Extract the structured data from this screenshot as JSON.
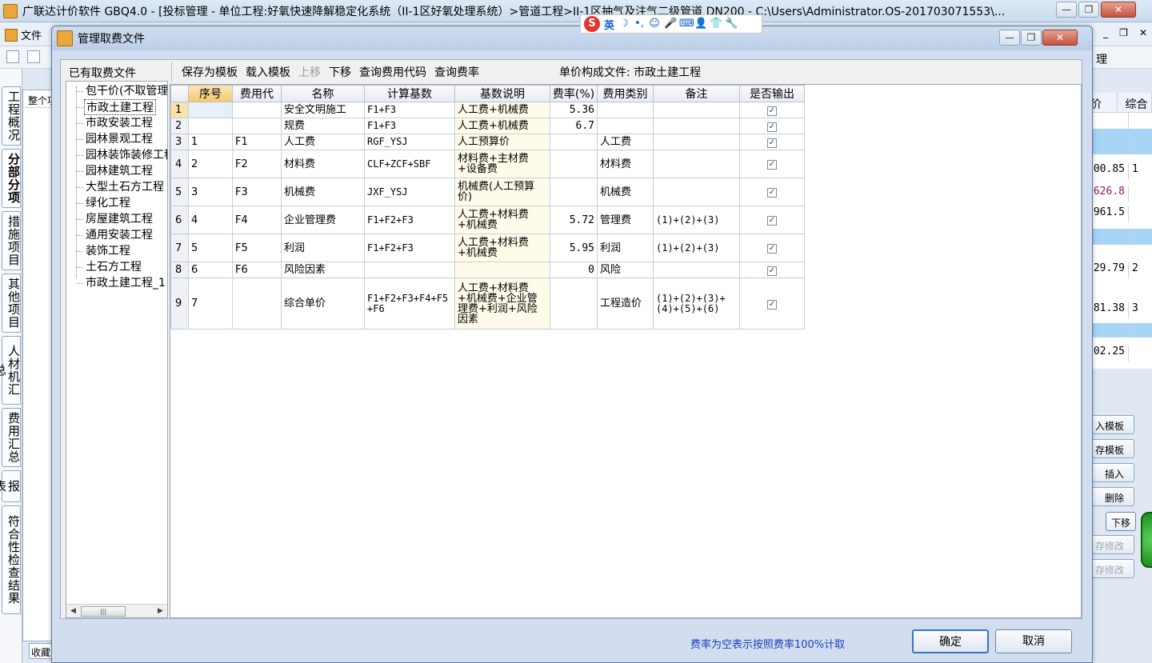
{
  "main_window": {
    "title": "广联达计价软件 GBQ4.0 - [投标管理 - 单位工程:好氧快速降解稳定化系统（II-1区好氧处理系统）>管道工程>II-1区抽气及注气二级管道 DN200 - C:\\Users\\Administrator.OS-201703071553\\...",
    "menu_file": "文件",
    "toolbar_right_label": "理",
    "left_tabs": [
      "工程概况",
      "分部分项",
      "措施项目",
      "其他项目",
      "人材机汇总",
      "费用汇总",
      "报表",
      "符合性检查结果"
    ],
    "left_panel_header": "整个项目",
    "bottom_tab": "收藏",
    "bg_grid_headers": [
      "价",
      "综合"
    ],
    "bg_grid_rows": [
      {
        "v1": "",
        "v2": ""
      },
      {
        "v1": "",
        "v2": ""
      },
      {
        "v1": "00.85",
        "v2": "1"
      },
      {
        "v1": "626.8",
        "v2": ""
      },
      {
        "v1": "961.5",
        "v2": ""
      },
      {
        "v1": "",
        "v2": ""
      },
      {
        "v1": "29.79",
        "v2": "2"
      },
      {
        "v1": "81.38",
        "v2": "3"
      },
      {
        "v1": "",
        "v2": ""
      },
      {
        "v1": "02.25",
        "v2": ""
      }
    ],
    "bg_buttons": [
      "入模板",
      "存模板",
      "插入",
      "删除",
      "存修改",
      "存修改"
    ],
    "bg_down_button": "下移"
  },
  "ime": {
    "logo": "S",
    "mode": "英",
    "icons": [
      "☽",
      "•,",
      "☺",
      "🎤",
      "⌨",
      "👤",
      "👕",
      "🔧"
    ]
  },
  "dialog": {
    "title": "管理取费文件",
    "tree_label": "已有取费文件",
    "tree_items": [
      "包干价(不取管理费)",
      "市政土建工程",
      "市政安装工程",
      "园林景观工程",
      "园林装饰装修工程",
      "园林建筑工程",
      "大型土石方工程",
      "绿化工程",
      "房屋建筑工程",
      "通用安装工程",
      "装饰工程",
      "土石方工程",
      "市政土建工程_1"
    ],
    "selected_item": "市政土建工程",
    "toolbar": {
      "save_template": "保存为模板",
      "load_template": "载入模板",
      "move_up": "上移",
      "move_down": "下移",
      "query_code": "查询费用代码",
      "query_rate": "查询费率"
    },
    "unit_file": "单价构成文件: 市政土建工程",
    "columns": [
      "序号",
      "费用代",
      "名称",
      "计算基数",
      "基数说明",
      "费率(%)",
      "费用类别",
      "备注",
      "是否输出"
    ],
    "rows": [
      {
        "rn": "1",
        "seq": "",
        "code": "",
        "name": "安全文明施工",
        "base": "F1+F3",
        "desc": "人工费+机械费",
        "rate": "5.36",
        "cat": "",
        "note": "",
        "out": true
      },
      {
        "rn": "2",
        "seq": "",
        "code": "",
        "name": "规费",
        "base": "F1+F3",
        "desc": "人工费+机械费",
        "rate": "6.7",
        "cat": "",
        "note": "",
        "out": true
      },
      {
        "rn": "3",
        "seq": "1",
        "code": "F1",
        "name": "人工费",
        "base": "RGF_YSJ",
        "desc": "人工预算价",
        "rate": "",
        "cat": "人工费",
        "note": "",
        "out": true
      },
      {
        "rn": "4",
        "seq": "2",
        "code": "F2",
        "name": "材料费",
        "base": "CLF+ZCF+SBF",
        "desc": "材料费+主材费+设备费",
        "rate": "",
        "cat": "材料费",
        "note": "",
        "out": true
      },
      {
        "rn": "5",
        "seq": "3",
        "code": "F3",
        "name": "机械费",
        "base": "JXF_YSJ",
        "desc": "机械费(人工预算价)",
        "rate": "",
        "cat": "机械费",
        "note": "",
        "out": true
      },
      {
        "rn": "6",
        "seq": "4",
        "code": "F4",
        "name": "企业管理费",
        "base": "F1+F2+F3",
        "desc": "人工费+材料费+机械费",
        "rate": "5.72",
        "cat": "管理费",
        "note": "(1)+(2)+(3)",
        "out": true
      },
      {
        "rn": "7",
        "seq": "5",
        "code": "F5",
        "name": "利润",
        "base": "F1+F2+F3",
        "desc": "人工费+材料费+机械费",
        "rate": "5.95",
        "cat": "利润",
        "note": "(1)+(2)+(3)",
        "out": true
      },
      {
        "rn": "8",
        "seq": "6",
        "code": "F6",
        "name": "风险因素",
        "base": "",
        "desc": "",
        "rate": "0",
        "cat": "风险",
        "note": "",
        "out": true
      },
      {
        "rn": "9",
        "seq": "7",
        "code": "",
        "name": "综合单价",
        "base": "F1+F2+F3+F4+F5+F6",
        "desc": "人工费+材料费+机械费+企业管理费+利润+风险因素",
        "rate": "",
        "cat": "工程造价",
        "note": "(1)+(2)+(3)+(4)+(5)+(6)",
        "out": true
      }
    ],
    "hint": "费率为空表示按照费率100%计取",
    "ok_label": "确定",
    "cancel_label": "取消"
  }
}
